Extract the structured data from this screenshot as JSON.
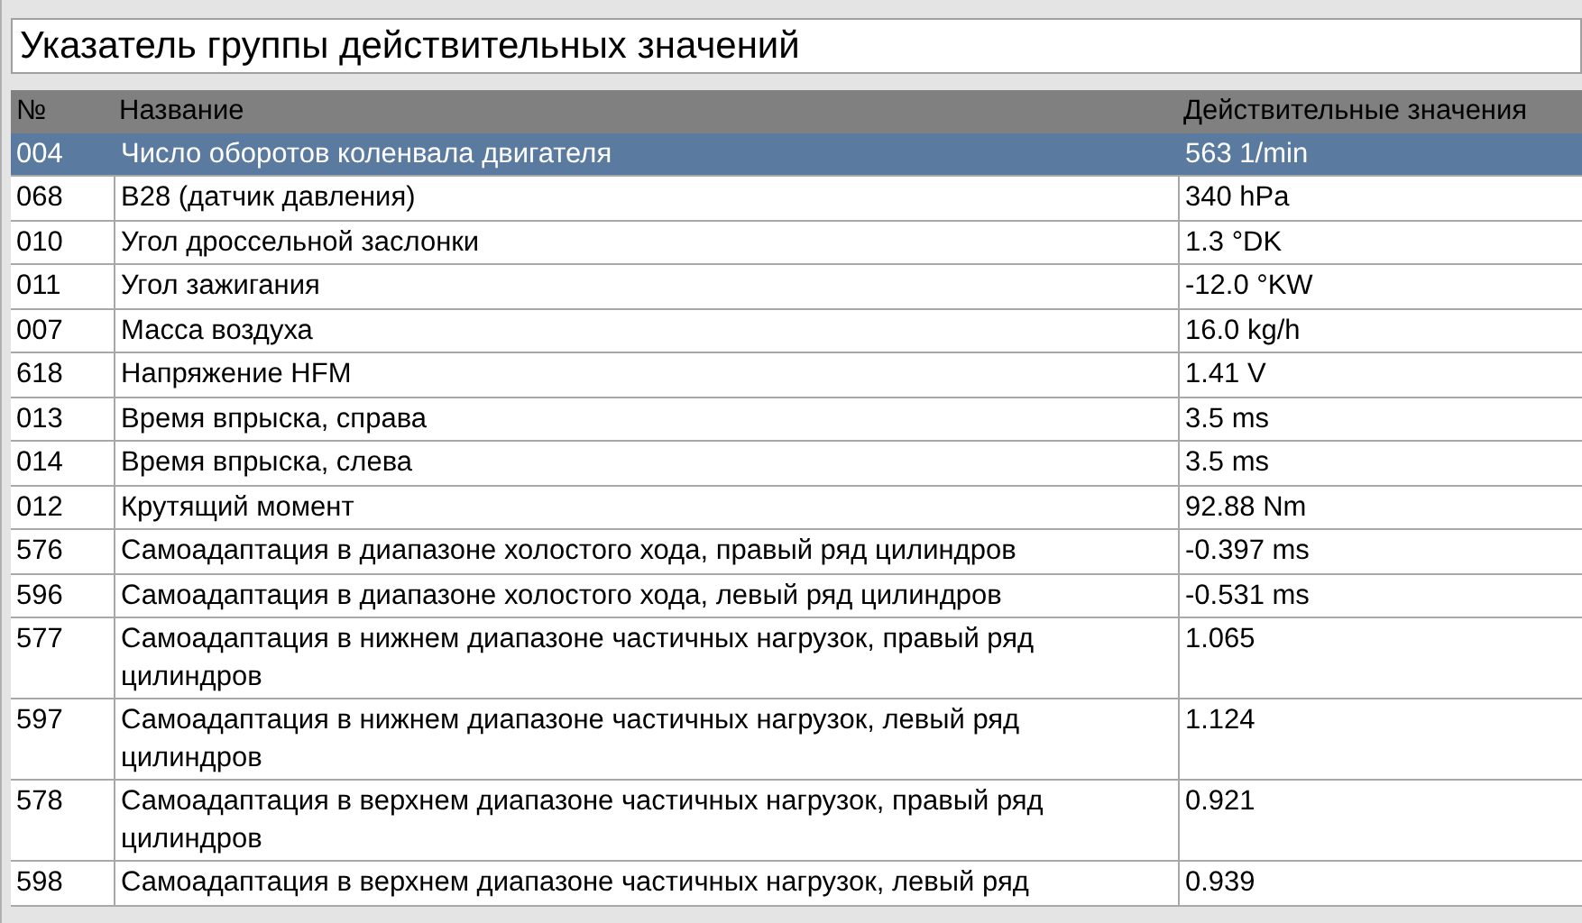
{
  "title": "Указатель группы действительных значений",
  "table": {
    "columns": [
      "№",
      "Название",
      "Действительные значения"
    ],
    "rows": [
      {
        "no": "004",
        "name": "Число оборотов коленвала двигателя",
        "value": "563 1/min",
        "selected": true
      },
      {
        "no": "068",
        "name": "B28 (датчик давления)",
        "value": "340 hPa",
        "selected": false
      },
      {
        "no": "010",
        "name": "Угол дроссельной заслонки",
        "value": "1.3 °DK",
        "selected": false
      },
      {
        "no": "011",
        "name": "Угол зажигания",
        "value": "-12.0 °KW",
        "selected": false
      },
      {
        "no": "007",
        "name": "Масса воздуха",
        "value": "16.0 kg/h",
        "selected": false
      },
      {
        "no": "618",
        "name": "Напряжение HFM",
        "value": "1.41 V",
        "selected": false
      },
      {
        "no": "013",
        "name": "Время впрыска, справа",
        "value": "3.5 ms",
        "selected": false
      },
      {
        "no": "014",
        "name": "Время впрыска, слева",
        "value": "3.5 ms",
        "selected": false
      },
      {
        "no": "012",
        "name": "Крутящий момент",
        "value": "92.88 Nm",
        "selected": false
      },
      {
        "no": "576",
        "name": "Самоадаптация в диапазоне холостого хода, правый ряд цилиндров",
        "value": "-0.397 ms",
        "selected": false
      },
      {
        "no": "596",
        "name": "Самоадаптация в диапазоне холостого хода, левый ряд цилиндров",
        "value": "-0.531 ms",
        "selected": false
      },
      {
        "no": "577",
        "name": "Самоадаптация в нижнем диапазоне частичных нагрузок, правый ряд цилиндров",
        "value": "1.065",
        "selected": false
      },
      {
        "no": "597",
        "name": "Самоадаптация в нижнем диапазоне частичных нагрузок, левый ряд цилиндров",
        "value": "1.124",
        "selected": false
      },
      {
        "no": "578",
        "name": "Самоадаптация в верхнем диапазоне частичных нагрузок, правый ряд цилиндров",
        "value": "0.921",
        "selected": false
      },
      {
        "no": "598",
        "name": "Самоадаптация в верхнем диапазоне частичных нагрузок, левый ряд",
        "value": "0.939",
        "selected": false
      }
    ]
  }
}
